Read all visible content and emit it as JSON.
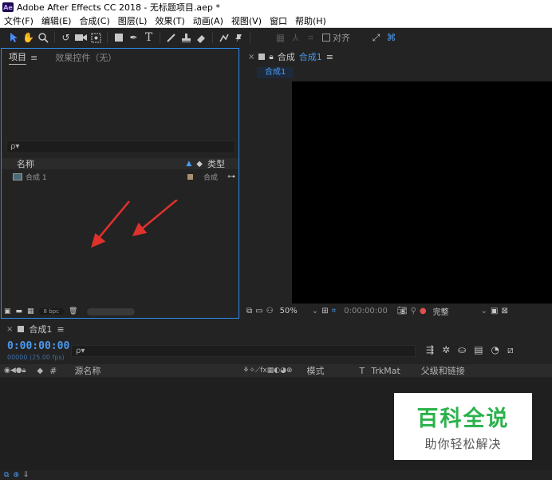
{
  "window": {
    "title": "Adobe After Effects CC 2018 - 无标题项目.aep *",
    "logo": "Ae"
  },
  "menu": [
    "文件(F)",
    "编辑(E)",
    "合成(C)",
    "图层(L)",
    "效果(T)",
    "动画(A)",
    "视图(V)",
    "窗口",
    "帮助(H)"
  ],
  "toolbar": {
    "icons": [
      "selection-tool",
      "hand-tool",
      "zoom-tool",
      "rotate-tool",
      "camera-tool",
      "pan-behind-tool",
      "rectangle-tool",
      "pen-tool",
      "type-tool",
      "brush-tool",
      "clone-stamp-tool",
      "eraser-tool",
      "roto-brush-tool",
      "puppet-pin-tool"
    ],
    "align_label": "对齐"
  },
  "project": {
    "tab_label": "项目",
    "tab_menu": "≡",
    "effects_tab": "效果控件（无）",
    "search_placeholder": "ρ▾",
    "col_name": "名称",
    "col_type": "类型",
    "items": [
      {
        "name": "合成 1",
        "type": "合成"
      }
    ],
    "bpc": "8 bpc"
  },
  "composition": {
    "tab_prefix": "合成",
    "tab_name": "合成1",
    "tab_menu": "≡",
    "subtab": "合成1",
    "zoom": "50%",
    "timecode": "0:00:00:00",
    "resolution": "完整"
  },
  "timeline": {
    "tab_label": "合成1",
    "tab_menu": "≡",
    "timecode": "0:00:00:00",
    "fps": "00000 (25.00 fps)",
    "search_placeholder": "ρ▾",
    "col_hash": "#",
    "col_source": "源名称",
    "col_mode": "模式",
    "col_t": "T",
    "col_trkmat": "TrkMat",
    "col_parent": "父级和链接"
  },
  "watermark": {
    "main": "百科全说",
    "sub": "助你轻松解决"
  },
  "colors": {
    "accent": "#2d8ceb",
    "time": "#4a9aef",
    "arrow": "#e0312b",
    "watermark": "#2bb24c"
  }
}
